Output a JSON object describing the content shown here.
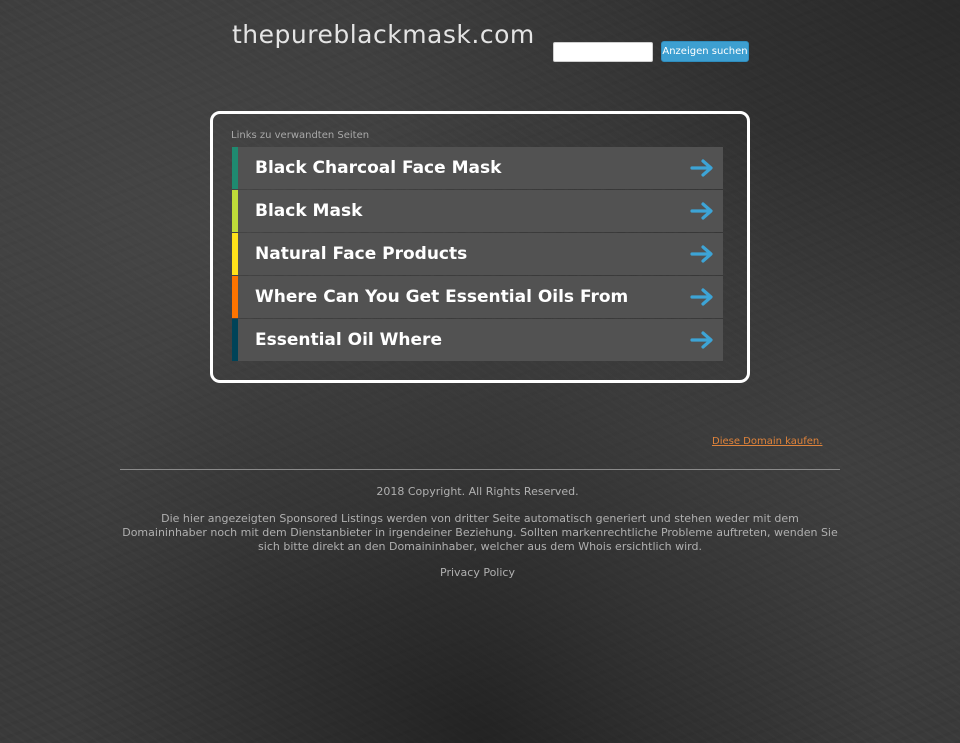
{
  "header": {
    "site_title": "thepureblackmask.com",
    "search_placeholder": "",
    "search_button_label": "Anzeigen suchen"
  },
  "related_links": {
    "heading": "Links zu verwandten Seiten",
    "items": [
      {
        "label": "Black Charcoal Face Mask",
        "accent_color": "#1f8a70"
      },
      {
        "label": "Black Mask",
        "accent_color": "#bedb39"
      },
      {
        "label": "Natural Face Products",
        "accent_color": "#ffe11a"
      },
      {
        "label": "Where Can You Get Essential Oils From",
        "accent_color": "#fd7400"
      },
      {
        "label": "Essential Oil Where",
        "accent_color": "#004358"
      }
    ],
    "arrow_icon": "arrow-right-icon",
    "arrow_color": "#3da4d6"
  },
  "buy_domain": {
    "label": "Diese Domain kaufen."
  },
  "footer": {
    "copyright": "2018 Copyright. All Rights Reserved.",
    "disclaimer": "Die hier angezeigten Sponsored Listings werden von dritter Seite automatisch generiert und stehen weder mit dem Domaininhaber noch mit dem Dienstanbieter in irgendeiner Beziehung. Sollten markenrechtliche Probleme auftreten, wenden Sie sich bitte direkt an den Domaininhaber, welcher aus dem Whois ersichtlich wird.",
    "privacy_label": "Privacy Policy"
  },
  "colors": {
    "background": "#3a3a3a",
    "link_background": "#525252",
    "search_button": "#3d9fd1",
    "buy_domain_link": "#e0833a"
  }
}
